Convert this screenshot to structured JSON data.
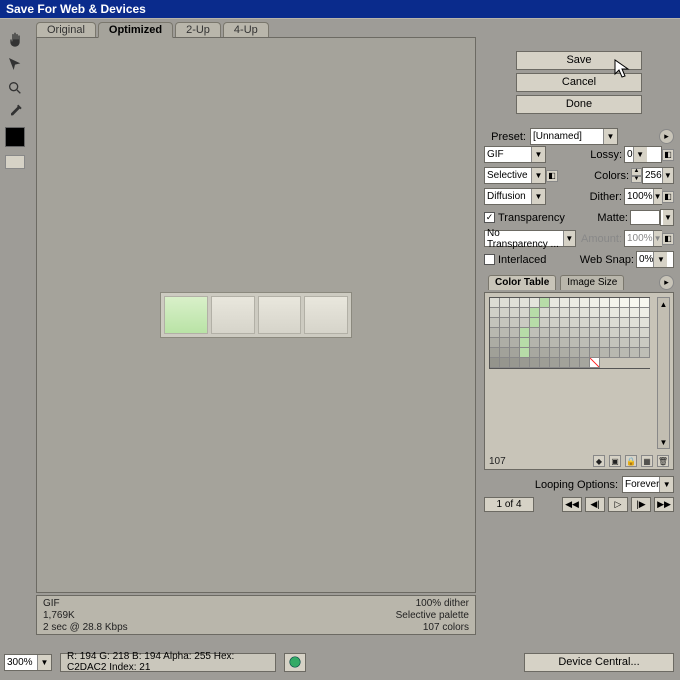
{
  "title": "Save For Web & Devices",
  "tabs": [
    "Original",
    "Optimized",
    "2-Up",
    "4-Up"
  ],
  "active_tab": 1,
  "buttons": {
    "save": "Save",
    "cancel": "Cancel",
    "done": "Done"
  },
  "preset": {
    "label": "Preset:",
    "value": "[Unnamed]"
  },
  "format": "GIF",
  "reduction": "Selective",
  "dither_method": "Diffusion",
  "lossy": {
    "label": "Lossy:",
    "value": "0"
  },
  "colors": {
    "label": "Colors:",
    "value": "256"
  },
  "dither": {
    "label": "Dither:",
    "value": "100%"
  },
  "transparency": {
    "label": "Transparency",
    "checked": true
  },
  "matte": {
    "label": "Matte:"
  },
  "trans_dither": "No Transparency ...",
  "amount": {
    "label": "Amount:",
    "value": "100%"
  },
  "interlaced": {
    "label": "Interlaced",
    "checked": false
  },
  "websnap": {
    "label": "Web Snap:",
    "value": "0%"
  },
  "color_tabs": [
    "Color Table",
    "Image Size"
  ],
  "color_count": "107",
  "looping": {
    "label": "Looping Options:",
    "value": "Forever"
  },
  "page": "1 of 4",
  "zoom": "300%",
  "info": {
    "format": "GIF",
    "size": "1,769K",
    "time": "2 sec @ 28.8 Kbps",
    "dither": "100% dither",
    "palette": "Selective palette",
    "cc": "107 colors"
  },
  "readout": "R:  194   G:  218   B:  194   Alpha:  255  Hex:  C2DAC2  Index:    21",
  "device_central": "Device Central...",
  "tool_names": [
    "hand-tool",
    "slice-select-tool",
    "zoom-tool",
    "eyedropper-tool"
  ]
}
